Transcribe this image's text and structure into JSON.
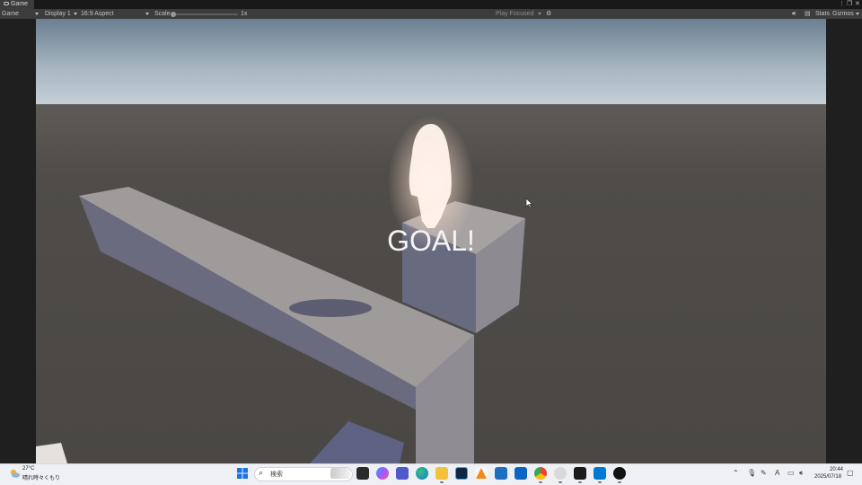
{
  "window": {
    "tab_label": "Game"
  },
  "toolbar": {
    "mode_select": "Game",
    "display_select": "Display 1",
    "aspect_select": "16:9 Aspect",
    "scale_label": "Scale",
    "scale_value": "1x",
    "play_focus_select": "Play Focused",
    "stats_label": "Stats",
    "gizmos_label": "Gizmos"
  },
  "game": {
    "goal_text": "GOAL!"
  },
  "taskbar": {
    "weather_temp": "27°C",
    "weather_desc": "晴れ時々くもり",
    "search_placeholder": "検索",
    "clock_time": "20:44",
    "clock_date": "2025/07/18"
  },
  "colors": {
    "unity_toolbar": "#3c3c3c",
    "unity_tabbar": "#191919",
    "ground": "#4a4744",
    "sky_top": "#6d8194",
    "platform_top": "#a29c9c",
    "platform_side": "#6a6b80",
    "taskbar_bg": "#eef0f4"
  }
}
